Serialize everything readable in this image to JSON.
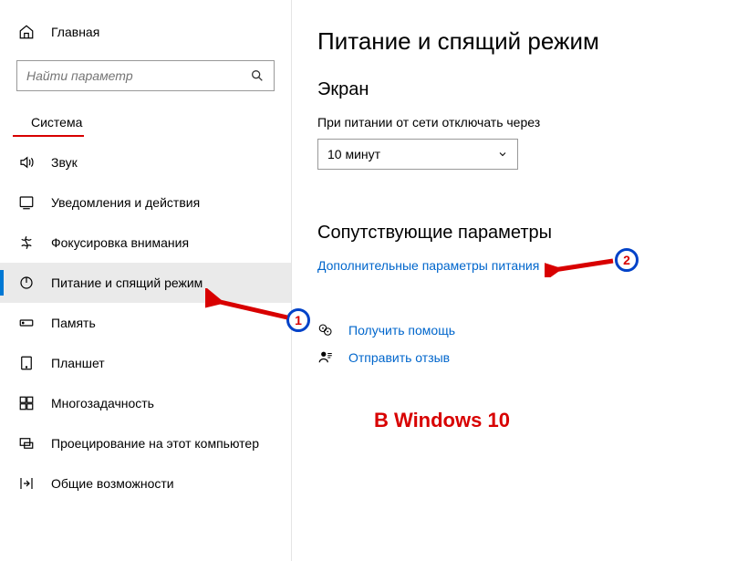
{
  "sidebar": {
    "home": "Главная",
    "search_placeholder": "Найти параметр",
    "category": "Система",
    "items": [
      {
        "label": "Звук"
      },
      {
        "label": "Уведомления и действия"
      },
      {
        "label": "Фокусировка внимания"
      },
      {
        "label": "Питание и спящий режим"
      },
      {
        "label": "Память"
      },
      {
        "label": "Планшет"
      },
      {
        "label": "Многозадачность"
      },
      {
        "label": "Проецирование на этот компьютер"
      },
      {
        "label": "Общие возможности"
      }
    ]
  },
  "main": {
    "title": "Питание и спящий режим",
    "screen_section": "Экран",
    "screen_label": "При питании от сети отключать через",
    "screen_value": "10 минут",
    "related_title": "Сопутствующие параметры",
    "related_link": "Дополнительные параметры питания",
    "help_link": "Получить помощь",
    "feedback_link": "Отправить отзыв"
  },
  "annotations": {
    "text": "В Windows 10",
    "badge1": "1",
    "badge2": "2"
  }
}
